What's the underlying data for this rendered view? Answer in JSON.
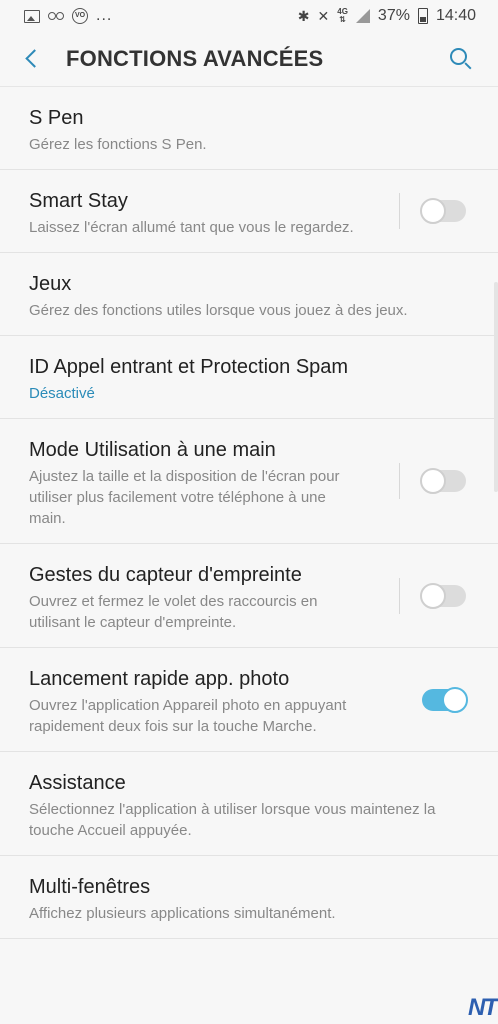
{
  "status_bar": {
    "left_icons": [
      "image-icon",
      "voicemail-icon",
      "volte-icon"
    ],
    "dots": "...",
    "net": "4G",
    "battery": "37%",
    "time": "14:40"
  },
  "header": {
    "title": "FONCTIONS AVANCÉES"
  },
  "items": [
    {
      "title": "S Pen",
      "subtitle": "Gérez les fonctions S Pen."
    },
    {
      "title": "Smart Stay",
      "subtitle": "Laissez l'écran allumé tant que vous le regardez.",
      "toggle": false
    },
    {
      "title": "Jeux",
      "subtitle": "Gérez des fonctions utiles lorsque vous jouez à des jeux."
    },
    {
      "title": "ID Appel entrant et Protection Spam",
      "subtitle": "Désactivé"
    },
    {
      "title": "Mode Utilisation à une main",
      "subtitle": "Ajustez la taille et la disposition de l'écran pour utiliser plus facilement votre téléphone à une main.",
      "toggle": false
    },
    {
      "title": "Gestes du capteur d'empreinte",
      "subtitle": "Ouvrez et fermez le volet des raccourcis en utilisant le capteur d'empreinte.",
      "toggle": false
    },
    {
      "title": "Lancement rapide app. photo",
      "subtitle": "Ouvrez l'application Appareil photo en appuyant rapidement deux fois sur la touche Marche.",
      "toggle": true
    },
    {
      "title": "Assistance",
      "subtitle": "Sélectionnez l'application à utiliser lorsque vous maintenez la touche Accueil appuyée."
    },
    {
      "title": "Multi-fenêtres",
      "subtitle": "Affichez plusieurs applications simultanément."
    }
  ],
  "accent_color": "#2e8ab8",
  "watermark": "NT"
}
